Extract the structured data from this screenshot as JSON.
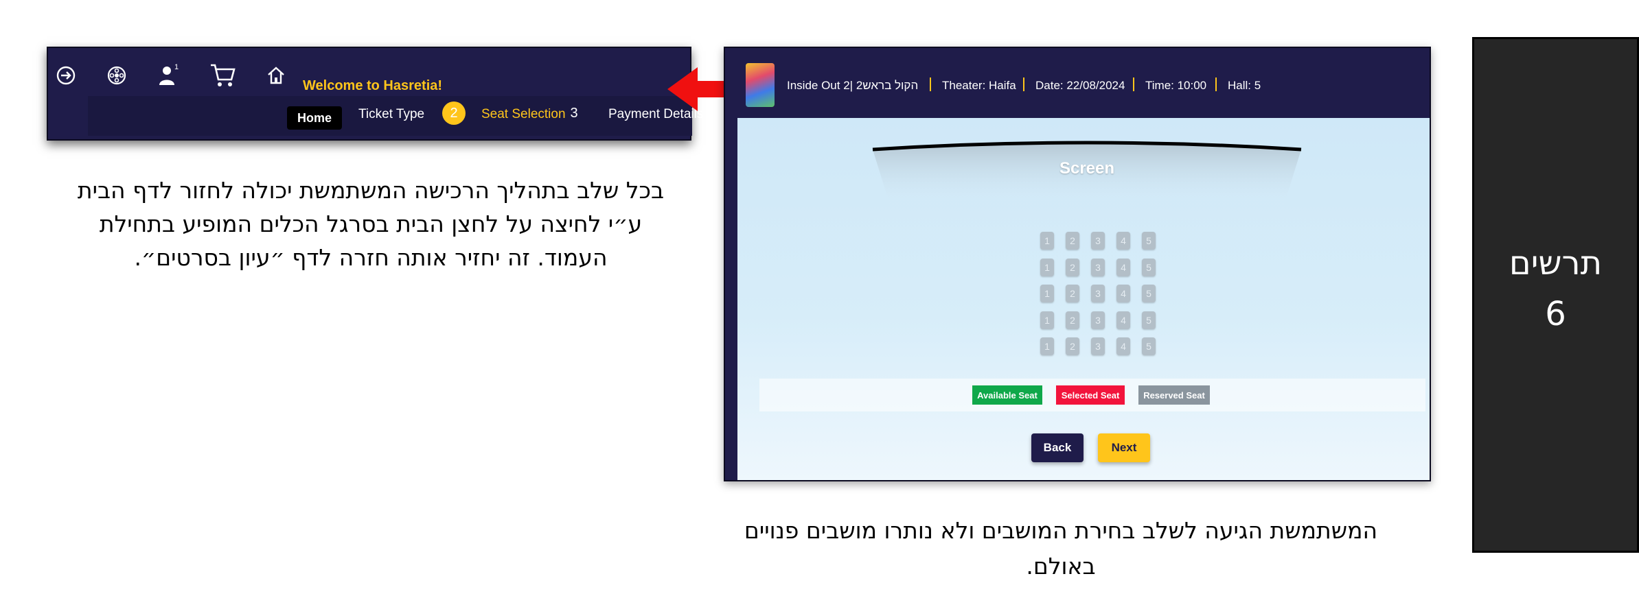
{
  "figure": {
    "label": "תרשים",
    "number": "6"
  },
  "nav": {
    "welcome": "Welcome to Hasretia!",
    "cart_badge": "1",
    "icons": [
      "logout-icon",
      "film-reel-icon",
      "user-icon",
      "cart-icon",
      "home-icon"
    ],
    "home_label": "Home",
    "steps": [
      {
        "label": "Ticket Type"
      },
      {
        "number": "2",
        "label": "Seat Selection",
        "active": true
      },
      {
        "number": "3",
        "label": "Payment Details"
      }
    ]
  },
  "desc_left": "בכל שלב בתהליך הרכישה המשתמשת יכולה לחזור לדף הבית ע״י לחיצה על לחצן הבית בסרגל הכלים המופיע בתחילת העמוד. זה יחזיר אותה חזרה לדף ״עיון בסרטים״.",
  "booking": {
    "movie": "Inside Out 2| הקול בראש2",
    "theater": "Theater: Haifa",
    "date": "Date: 22/08/2024",
    "time": "Time: 10:00",
    "hall": "Hall: 5",
    "screen_label": "Screen",
    "seat_rows": 5,
    "seat_numbers": [
      "1",
      "2",
      "3",
      "4",
      "5"
    ],
    "legend": [
      {
        "label": "Available Seat",
        "color": "#0fa84a"
      },
      {
        "label": "Selected Seat",
        "color": "#f2143c"
      },
      {
        "label": "Reserved Seat",
        "color": "#8a959e"
      }
    ],
    "back_label": "Back",
    "next_label": "Next"
  },
  "desc_right": "המשתמשת הגיעה לשלב בחירת המושבים ולא נותרו מושבים פנויים באולם.",
  "colors": {
    "navy": "#1f1c4a",
    "accent": "#ffc51b",
    "arrow": "#f01010"
  }
}
